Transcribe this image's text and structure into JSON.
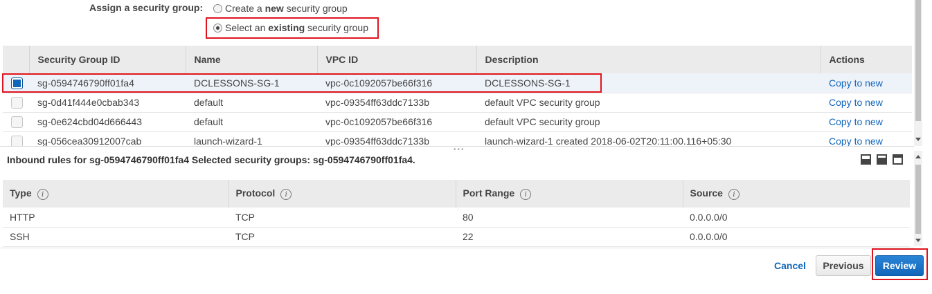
{
  "assign": {
    "label": "Assign a security group:",
    "option_new_pre": "Create a ",
    "option_new_bold": "new",
    "option_new_post": " security group",
    "option_existing_pre": "Select an ",
    "option_existing_bold": "existing",
    "option_existing_post": " security group",
    "selected": "existing"
  },
  "sg_table": {
    "columns": [
      "Security Group ID",
      "Name",
      "VPC ID",
      "Description",
      "Actions"
    ],
    "rows": [
      {
        "id": "sg-0594746790ff01fa4",
        "name": "DCLESSONS-SG-1",
        "vpc": "vpc-0c1092057be66f316",
        "description": "DCLESSONS-SG-1",
        "action": "Copy to new",
        "selected": true
      },
      {
        "id": "sg-0d41f444e0cbab343",
        "name": "default",
        "vpc": "vpc-09354ff63ddc7133b",
        "description": "default VPC security group",
        "action": "Copy to new",
        "selected": false
      },
      {
        "id": "sg-0e624cbd04d666443",
        "name": "default",
        "vpc": "vpc-0c1092057be66f316",
        "description": "default VPC security group",
        "action": "Copy to new",
        "selected": false
      },
      {
        "id": "sg-056cea30912007cab",
        "name": "launch-wizard-1",
        "vpc": "vpc-09354ff63ddc7133b",
        "description": "launch-wizard-1 created 2018-06-02T20:11:00.116+05:30",
        "action": "Copy to new",
        "selected": false
      }
    ]
  },
  "inbound": {
    "title": "Inbound rules for sg-0594746790ff01fa4 Selected security groups: sg-0594746790ff01fa4.",
    "columns": [
      "Type",
      "Protocol",
      "Port Range",
      "Source"
    ],
    "rows": [
      {
        "type": "HTTP",
        "protocol": "TCP",
        "port": "80",
        "source": "0.0.0.0/0"
      },
      {
        "type": "SSH",
        "protocol": "TCP",
        "port": "22",
        "source": "0.0.0.0/0"
      }
    ]
  },
  "footer": {
    "cancel": "Cancel",
    "previous": "Previous",
    "review": "Review"
  },
  "colors": {
    "accent": "#1166bb",
    "highlight": "#e0141e"
  }
}
